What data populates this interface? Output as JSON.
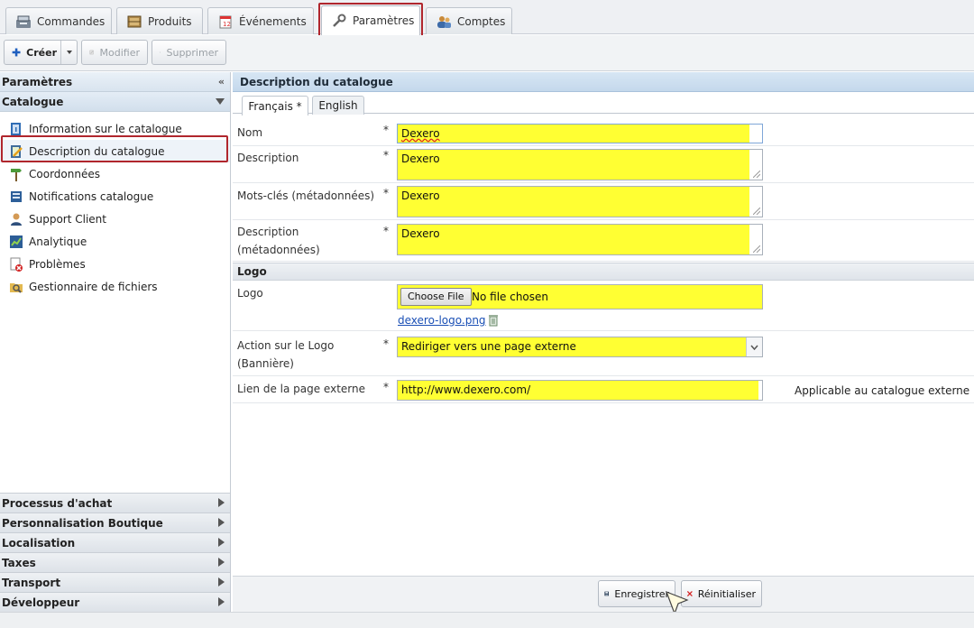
{
  "top_tabs": [
    {
      "label": "Commandes",
      "icon": "register-icon"
    },
    {
      "label": "Produits",
      "icon": "box-icon"
    },
    {
      "label": "Événements",
      "icon": "calendar-icon"
    },
    {
      "label": "Paramètres",
      "icon": "wrench-icon",
      "active": true
    },
    {
      "label": "Comptes",
      "icon": "users-icon"
    }
  ],
  "toolbar": {
    "create_label": "Créer",
    "edit_label": "Modifier",
    "delete_label": "Supprimer"
  },
  "sidebar": {
    "title": "Paramètres",
    "group": "Catalogue",
    "items": [
      {
        "label": "Information sur le catalogue",
        "icon": "info-book-icon"
      },
      {
        "label": "Description du catalogue",
        "icon": "edit-note-icon",
        "selected": true
      },
      {
        "label": "Coordonnées",
        "icon": "signpost-icon"
      },
      {
        "label": "Notifications catalogue",
        "icon": "notification-icon"
      },
      {
        "label": "Support Client",
        "icon": "user-support-icon"
      },
      {
        "label": "Analytique",
        "icon": "chart-icon"
      },
      {
        "label": "Problèmes",
        "icon": "error-page-icon"
      },
      {
        "label": "Gestionnaire de fichiers",
        "icon": "file-manager-icon"
      }
    ],
    "sections": [
      "Processus d'achat",
      "Personnalisation Boutique",
      "Localisation",
      "Taxes",
      "Transport",
      "Développeur"
    ]
  },
  "main": {
    "title": "Description du catalogue",
    "lang_tabs": [
      "Français *",
      "English"
    ],
    "fields": {
      "nom": {
        "label": "Nom",
        "required": "*",
        "value": "Dexero"
      },
      "description": {
        "label": "Description",
        "required": "*",
        "value": "Dexero"
      },
      "mots_cles": {
        "label": "Mots-clés (métadonnées)",
        "required": "*",
        "value": "Dexero"
      },
      "desc_meta": {
        "label_line1": "Description",
        "label_line2": "(métadonnées)",
        "required": "*",
        "value": "Dexero"
      }
    },
    "logo_section": "Logo",
    "logo": {
      "label": "Logo",
      "choose_button": "Choose File",
      "no_file": "No file chosen",
      "file_link": "dexero-logo.png"
    },
    "action_logo": {
      "label_line1": "Action sur le Logo",
      "label_line2": "(Bannière)",
      "required": "*",
      "selected": "Rediriger vers une page externe"
    },
    "external_link": {
      "label": "Lien de la page externe",
      "required": "*",
      "value": "http://www.dexero.com/",
      "hint": "Applicable au catalogue externe"
    }
  },
  "footer": {
    "save_label": "Enregistrer",
    "reset_label": "Réinitialiser"
  },
  "colors": {
    "highlight": "#ffff33",
    "annotation_border": "#b0262d",
    "panel_header": "#c4d8ec"
  }
}
